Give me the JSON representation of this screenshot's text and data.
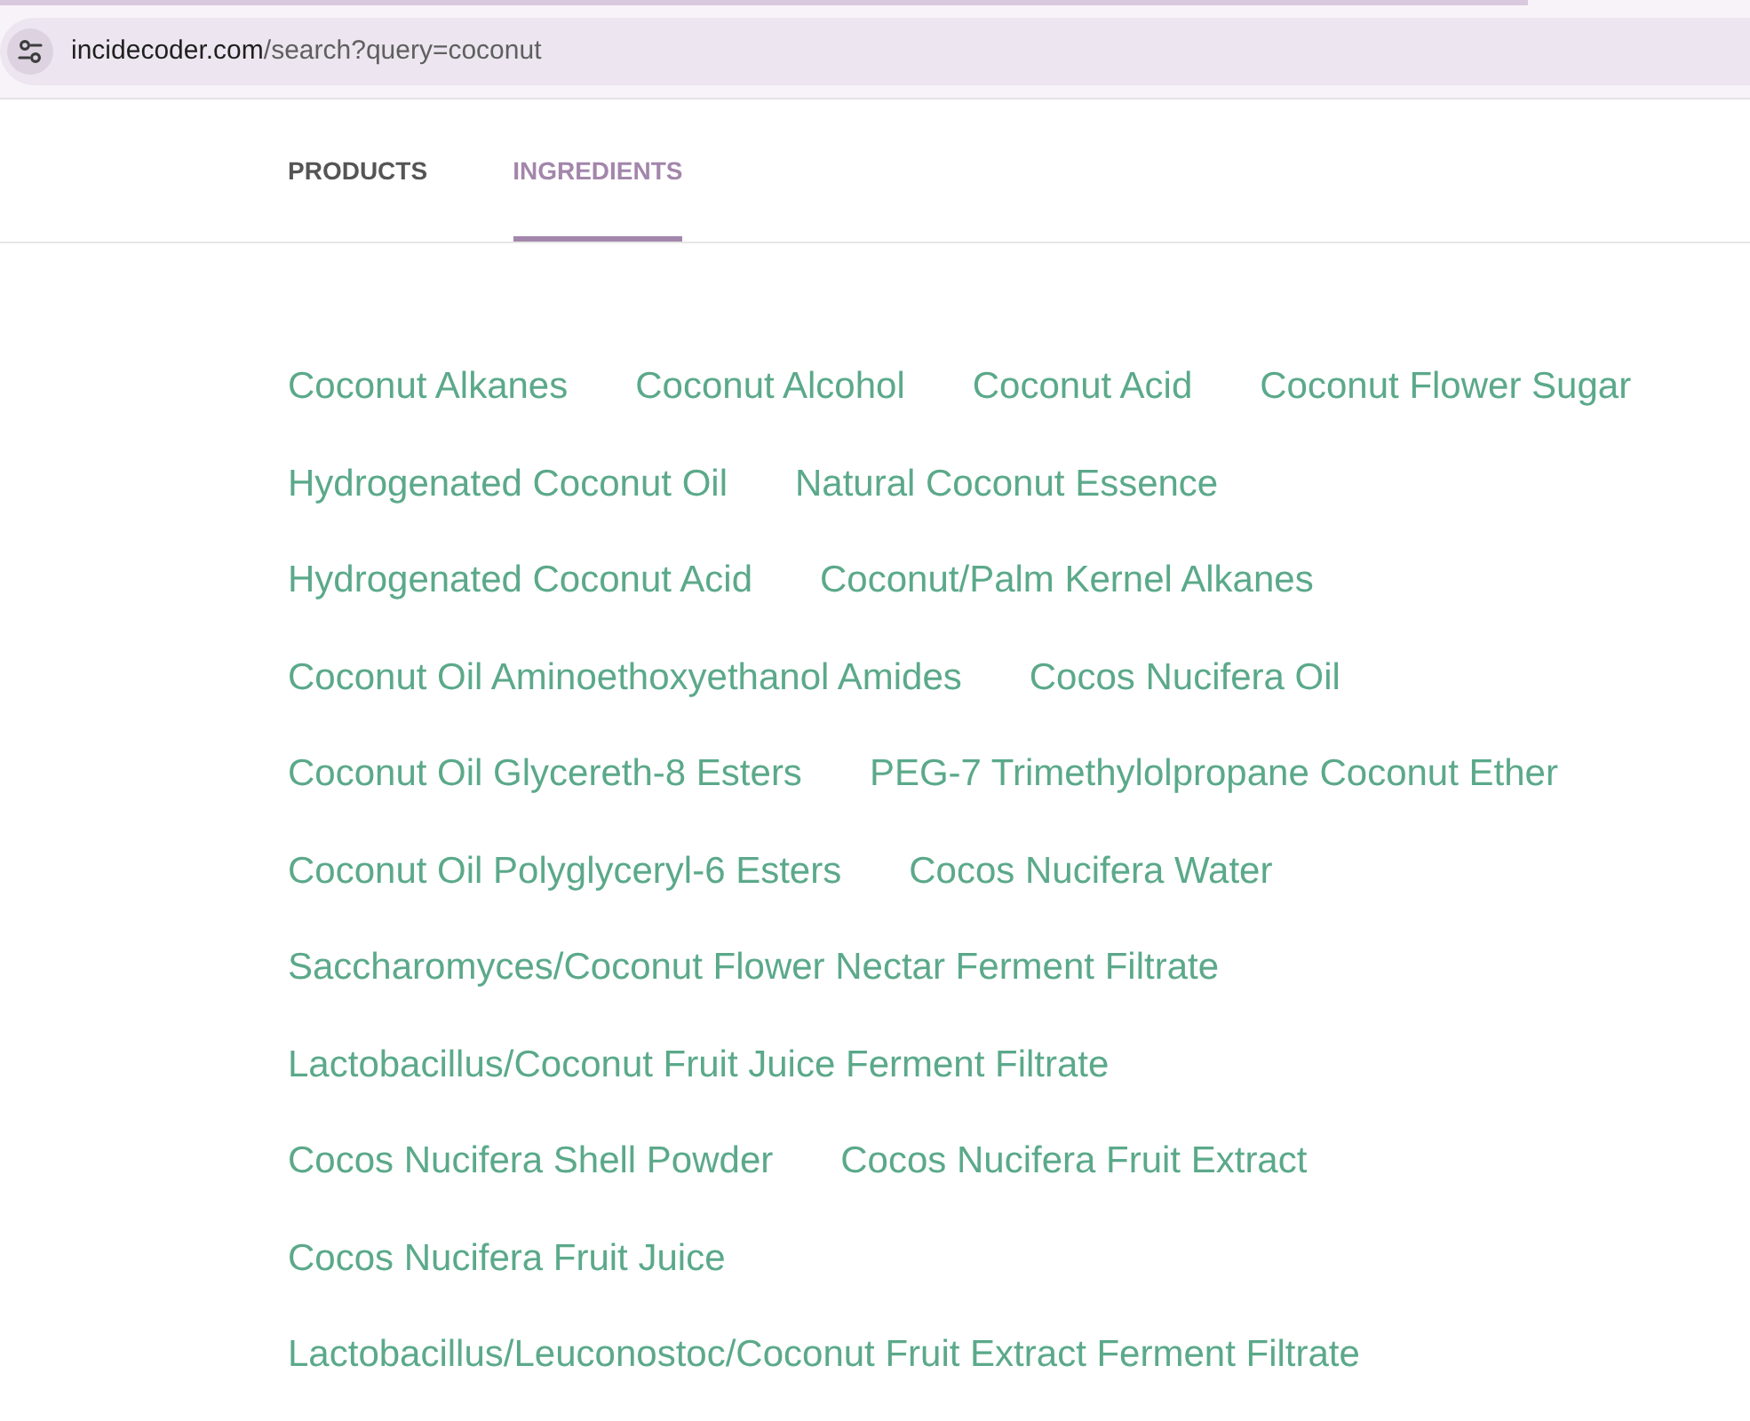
{
  "address_bar": {
    "host": "incidecoder.com",
    "path": "/search?query=coconut"
  },
  "tabs": [
    {
      "label": "PRODUCTS",
      "selected": false
    },
    {
      "label": "INGREDIENTS",
      "selected": true
    }
  ],
  "ingredients": [
    "Coconut Alkanes",
    "Coconut Alcohol",
    "Coconut Acid",
    "Coconut Flower Sugar",
    "Hydrogenated Coconut Oil",
    "Natural Coconut Essence",
    "Hydrogenated Coconut Acid",
    "Coconut/Palm Kernel Alkanes",
    "Coconut Oil Aminoethoxyethanol Amides",
    "Cocos Nucifera Oil",
    "Coconut Oil Glycereth-8 Esters",
    "PEG-7 Trimethylolpropane Coconut Ether",
    "Coconut Oil Polyglyceryl-6 Esters",
    "Cocos Nucifera Water",
    "Saccharomyces/Coconut Flower Nectar Ferment Filtrate",
    "Lactobacillus/Coconut Fruit Juice Ferment Filtrate",
    "Cocos Nucifera Shell Powder",
    "Cocos Nucifera Fruit Extract",
    "Cocos Nucifera Fruit Juice",
    "Lactobacillus/Leuconostoc/Coconut Fruit Extract Ferment Filtrate"
  ]
}
